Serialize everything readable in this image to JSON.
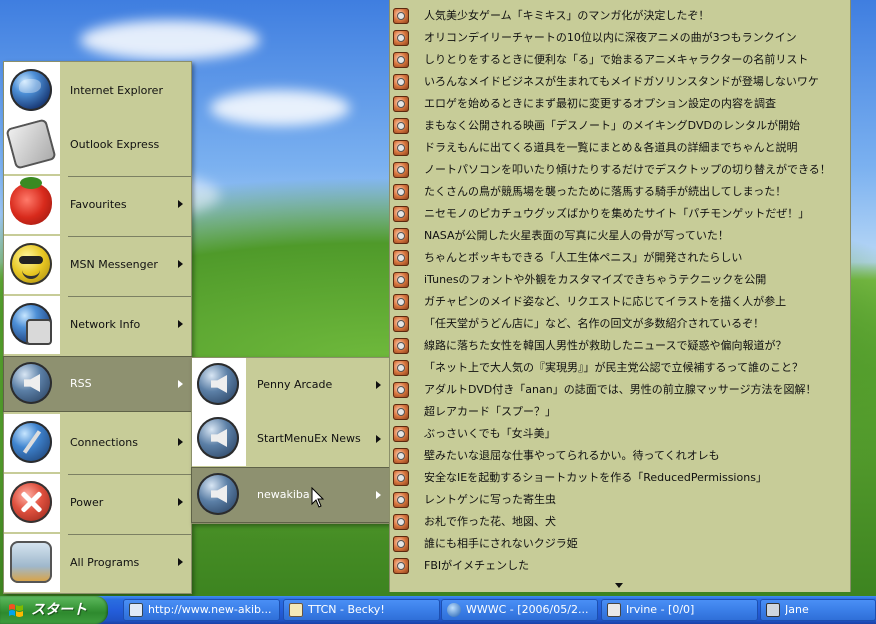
{
  "start_menu": {
    "items": [
      {
        "label": "Internet Explorer",
        "icon": "internet-explorer-icon",
        "submenu": false
      },
      {
        "label": "Outlook Express",
        "icon": "outlook-express-icon",
        "submenu": false
      },
      {
        "label": "Favourites",
        "icon": "strawberry-favourites-icon",
        "submenu": true
      },
      {
        "label": "MSN Messenger",
        "icon": "messenger-smiley-icon",
        "submenu": true
      },
      {
        "label": "Network Info",
        "icon": "network-info-icon",
        "submenu": true
      },
      {
        "label": "RSS",
        "icon": "rss-speaker-icon",
        "submenu": true,
        "selected": true
      },
      {
        "label": "Connections",
        "icon": "connections-globe-icon",
        "submenu": true
      },
      {
        "label": "Power",
        "icon": "power-x-icon",
        "submenu": true
      },
      {
        "label": "All Programs",
        "icon": "all-programs-jar-icon",
        "submenu": true
      }
    ]
  },
  "rss_submenu": {
    "items": [
      {
        "label": "Penny Arcade",
        "icon": "rss-speaker-icon"
      },
      {
        "label": "StartMenuEx News",
        "icon": "rss-speaker-icon"
      },
      {
        "label": "newakiba",
        "icon": "rss-speaker-icon",
        "selected": true
      }
    ]
  },
  "feed": {
    "items": [
      "人気美少女ゲーム「キミキス」のマンガ化が決定したぞ！",
      "オリコンデイリーチャートの10位以内に深夜アニメの曲が3つもランクイン",
      "しりとりをするときに便利な「る」で始まるアニメキャラクターの名前リスト",
      "いろんなメイドビジネスが生まれてもメイドガソリンスタンドが登場しないワケ",
      "エロゲを始めるときにまず最初に変更するオプション設定の内容を調査",
      "まもなく公開される映画「デスノート」のメイキングDVDのレンタルが開始",
      "ドラえもんに出てくる道具を一覧にまとめ＆各道具の詳細までちゃんと説明",
      "ノートパソコンを叩いたり傾けたりするだけでデスクトップの切り替えができる！",
      "たくさんの鳥が競馬場を襲ったために落馬する騎手が続出してしまった！",
      "ニセモノのピカチュウグッズばかりを集めたサイト「パチモンゲットだぜ！」",
      "NASAが公開した火星表面の写真に火星人の骨が写っていた！",
      "ちゃんとボッキもできる「人工生体ペニス」が開発されたらしい",
      "iTunesのフォントや外観をカスタマイズできちゃうテクニックを公開",
      "ガチャピンのメイド姿など、リクエストに応じてイラストを描く人が参上",
      "「任天堂がうどん店に」など、名作の回文が多数紹介されているぞ！",
      "線路に落ちた女性を韓国人男性が救助したニュースで疑惑や偏向報道が？",
      "「ネット上で大人気の『実現男』」が民主党公認で立候補するって誰のこと？",
      "アダルトDVD付き「anan」の誌面では、男性の前立腺マッサージ方法を図解！",
      "超レアカード「スプー？」",
      "ぶっさいくでも「女斗美」",
      "壁みたいな退屈な仕事やってられるかい。待ってくれオレも",
      "安全なIEを起動するショートカットを作る「ReducedPermissions」",
      "レントゲンに写った寄生虫",
      "お札で作った花、地図、犬",
      "誰にも相手にされないクジラ姫",
      "FBIがイメチェンした"
    ]
  },
  "taskbar": {
    "start_label": "スタート",
    "tasks": [
      {
        "label": "http://www.new-akib...",
        "icon": "ie-page-icon"
      },
      {
        "label": "TTCN - Becky!",
        "icon": "becky-mail-icon"
      },
      {
        "label": "WWWC - [2006/05/2...",
        "icon": "wwwc-globe-icon"
      },
      {
        "label": "Irvine - [0/0]",
        "icon": "irvine-icon"
      },
      {
        "label": "Jane",
        "icon": "jane-icon"
      }
    ]
  },
  "colors": {
    "menu_bg": "#c7cc98",
    "menu_selected": "#8e9170",
    "taskbar_blue": "#245edb",
    "start_green": "#3c9a3c"
  }
}
